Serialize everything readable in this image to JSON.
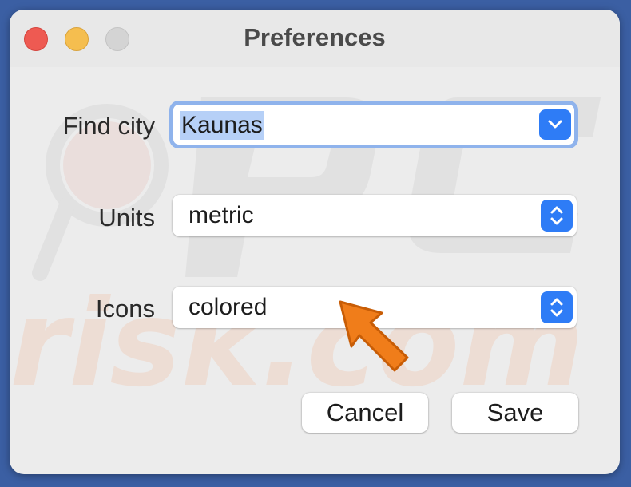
{
  "window": {
    "title": "Preferences"
  },
  "form": {
    "find_city_label": "Find city",
    "find_city_value": "Kaunas",
    "units_label": "Units",
    "units_value": "metric",
    "icons_label": "Icons",
    "icons_value": "colored"
  },
  "buttons": {
    "cancel": "Cancel",
    "save": "Save"
  },
  "watermark": {
    "logo_text": "PC risk.com"
  },
  "icons": {
    "close": "close-traffic-light",
    "minimize": "minimize-traffic-light",
    "zoom": "zoom-traffic-light",
    "combo_dropdown": "chevron-down-icon",
    "popup_stepper": "chevron-up-down-icon",
    "pointer": "orange-arrow-icon"
  },
  "colors": {
    "accent": "#2e7cf6",
    "focus_ring": "#8fb3ec",
    "selection": "#b6d0f7",
    "close": "#ee5a52",
    "minimize": "#f5be4f",
    "arrow": "#f07d1a"
  }
}
